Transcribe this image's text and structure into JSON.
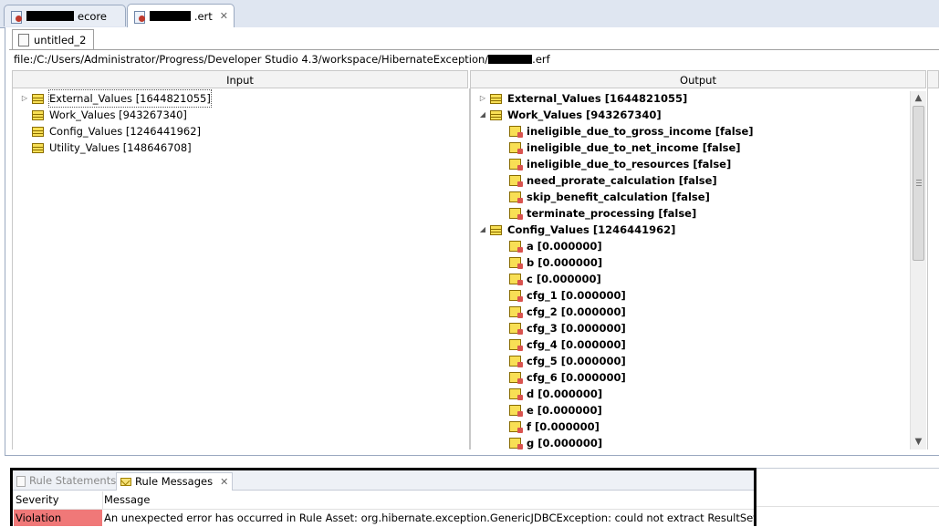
{
  "editor_tabs": [
    {
      "label": "ecore",
      "active": false
    },
    {
      "label": ".ert",
      "active": true
    }
  ],
  "diagram_tab": {
    "label": "untitled_2"
  },
  "file_path": {
    "prefix": "file:/C:/Users/Administrator/Progress/Developer Studio 4.3/workspace/HibernateException/",
    "suffix": ".erf"
  },
  "input_pane": {
    "header": "Input",
    "items": [
      {
        "label": "External_Values [1644821055]",
        "expandable": true
      },
      {
        "label": "Work_Values [943267340]",
        "expandable": false
      },
      {
        "label": "Config_Values [1246441962]",
        "expandable": false
      },
      {
        "label": "Utility_Values [148646708]",
        "expandable": false
      }
    ]
  },
  "output_pane": {
    "header": "Output",
    "rows": [
      {
        "label": "External_Values [1644821055]",
        "kind": "table",
        "level": 0,
        "expander": "collapsed"
      },
      {
        "label": "Work_Values [943267340]",
        "kind": "table",
        "level": 0,
        "expander": "expanded"
      },
      {
        "label": "ineligible_due_to_gross_income [false]",
        "kind": "attr",
        "level": 1
      },
      {
        "label": "ineligible_due_to_net_income [false]",
        "kind": "attr",
        "level": 1
      },
      {
        "label": "ineligible_due_to_resources [false]",
        "kind": "attr",
        "level": 1
      },
      {
        "label": "need_prorate_calculation [false]",
        "kind": "attr",
        "level": 1
      },
      {
        "label": "skip_benefit_calculation [false]",
        "kind": "attr",
        "level": 1
      },
      {
        "label": "terminate_processing [false]",
        "kind": "attr",
        "level": 1
      },
      {
        "label": "Config_Values [1246441962]",
        "kind": "table",
        "level": 0,
        "expander": "expanded"
      },
      {
        "label": "a [0.000000]",
        "kind": "attr",
        "level": 1
      },
      {
        "label": "b [0.000000]",
        "kind": "attr",
        "level": 1
      },
      {
        "label": "c [0.000000]",
        "kind": "attr",
        "level": 1
      },
      {
        "label": "cfg_1 [0.000000]",
        "kind": "attr",
        "level": 1
      },
      {
        "label": "cfg_2 [0.000000]",
        "kind": "attr",
        "level": 1
      },
      {
        "label": "cfg_3 [0.000000]",
        "kind": "attr",
        "level": 1
      },
      {
        "label": "cfg_4 [0.000000]",
        "kind": "attr",
        "level": 1
      },
      {
        "label": "cfg_5 [0.000000]",
        "kind": "attr",
        "level": 1
      },
      {
        "label": "cfg_6 [0.000000]",
        "kind": "attr",
        "level": 1
      },
      {
        "label": "d [0.000000]",
        "kind": "attr",
        "level": 1
      },
      {
        "label": "e [0.000000]",
        "kind": "attr",
        "level": 1
      },
      {
        "label": "f [0.000000]",
        "kind": "attr",
        "level": 1
      },
      {
        "label": "g [0.000000]",
        "kind": "attr",
        "level": 1
      }
    ]
  },
  "messages_panel": {
    "tabs": [
      {
        "label": "Rule Statements",
        "active": false
      },
      {
        "label": "Rule Messages",
        "active": true
      }
    ],
    "columns": {
      "severity": "Severity",
      "message": "Message"
    },
    "rows": [
      {
        "severity": "Violation",
        "message": "An unexpected error has occurred in Rule Asset: org.hibernate.exception.GenericJDBCException: could not extract ResultSet"
      }
    ],
    "colors": {
      "violation": "#f07878"
    }
  }
}
